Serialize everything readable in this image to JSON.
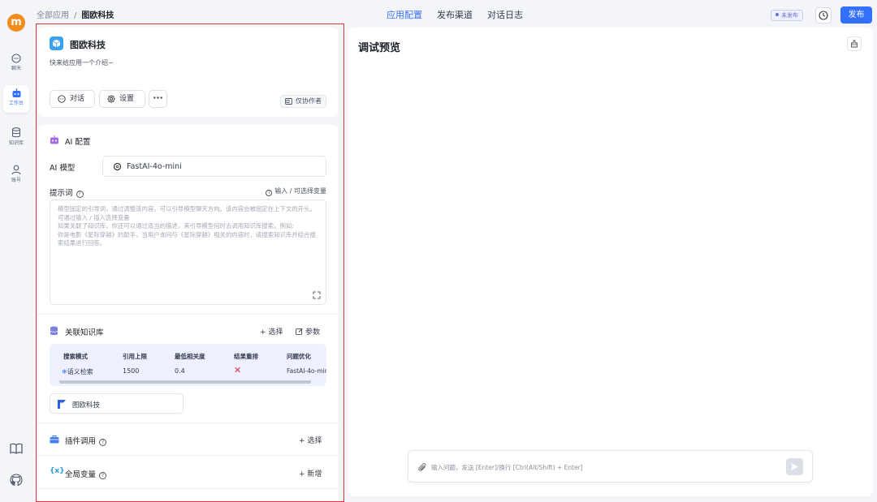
{
  "app": {
    "logo_letter": "m"
  },
  "rail": {
    "items": [
      {
        "label": "聊天",
        "icon": "chat-bubble-icon"
      },
      {
        "label": "工作台",
        "icon": "robot-icon"
      },
      {
        "label": "知识库",
        "icon": "database-icon"
      },
      {
        "label": "账号",
        "icon": "user-icon"
      }
    ],
    "bottom": [
      {
        "icon": "book-icon"
      },
      {
        "icon": "github-icon"
      }
    ]
  },
  "breadcrumb": {
    "root": "全部应用",
    "separator": "/",
    "current": "图欧科技"
  },
  "topnav": {
    "tabs": [
      "应用配置",
      "发布渠道",
      "对话日志"
    ],
    "active": 0
  },
  "header": {
    "status": "未发布",
    "publish": "发布"
  },
  "app_card": {
    "name": "图欧科技",
    "intro": "快来给应用一个介绍~",
    "chat_btn": "对话",
    "settings_btn": "设置",
    "more": "···",
    "collab": "仅协作者"
  },
  "ai_config": {
    "title": "AI 配置",
    "model_label": "AI 模型",
    "model_value": "FastAI-4o-mini",
    "prompt_label": "提示词",
    "var_hint": "输入 / 可选择变量",
    "prompt_placeholder": "模型固定的引导词，通过调整该内容，可以引导模型聊天方向。该内容会被固定在上下文的开头。可通过输入 / 插入选择变量\n如果关联了知识库，你还可以通过适当的描述，来引导模型何时去调用知识库搜索。例如:\n你是电影《星际穿越》的助手，当用户询问与《星际穿越》相关的内容时，请搜索知识库并结合搜索结果进行回答。"
  },
  "kb": {
    "title": "关联知识库",
    "select": "+ 选择",
    "params": "参数",
    "columns": [
      "搜索模式",
      "引用上限",
      "最低相关度",
      "结果重排",
      "问题优化"
    ],
    "row": {
      "mode": "语义检索",
      "limit": "1500",
      "similarity": "0.4",
      "rerank": "✕",
      "optimize": "FastAI-4o-mini"
    },
    "item_name": "图欧科技"
  },
  "plugins": {
    "title": "插件调用",
    "action": "+ 选择"
  },
  "vars": {
    "title": "全局变量",
    "action": "+ 新增"
  },
  "preview": {
    "title": "调试预览",
    "input_placeholder": "输入问题，发送 [Enter]/换行 [Ctrl(Alt/Shift) + Enter]"
  },
  "colors": {
    "accent": "#3370ff",
    "logo": "#f28c1a",
    "frame": "#e0323c"
  }
}
